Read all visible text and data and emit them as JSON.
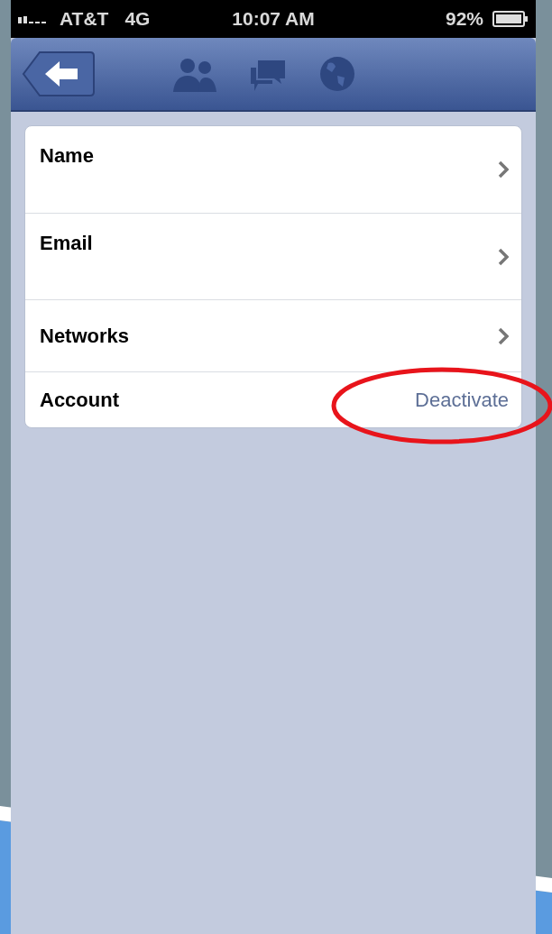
{
  "status_bar": {
    "carrier": "AT&T",
    "network": "4G",
    "time": "10:07 AM",
    "battery": "92%"
  },
  "rows": [
    {
      "kind": "link",
      "label": "Name",
      "tall": true
    },
    {
      "kind": "link",
      "label": "Email",
      "tall": true
    },
    {
      "kind": "link",
      "label": "Networks",
      "tall": false
    },
    {
      "kind": "action",
      "label": "Account",
      "action": "Deactivate",
      "circled": true
    }
  ]
}
